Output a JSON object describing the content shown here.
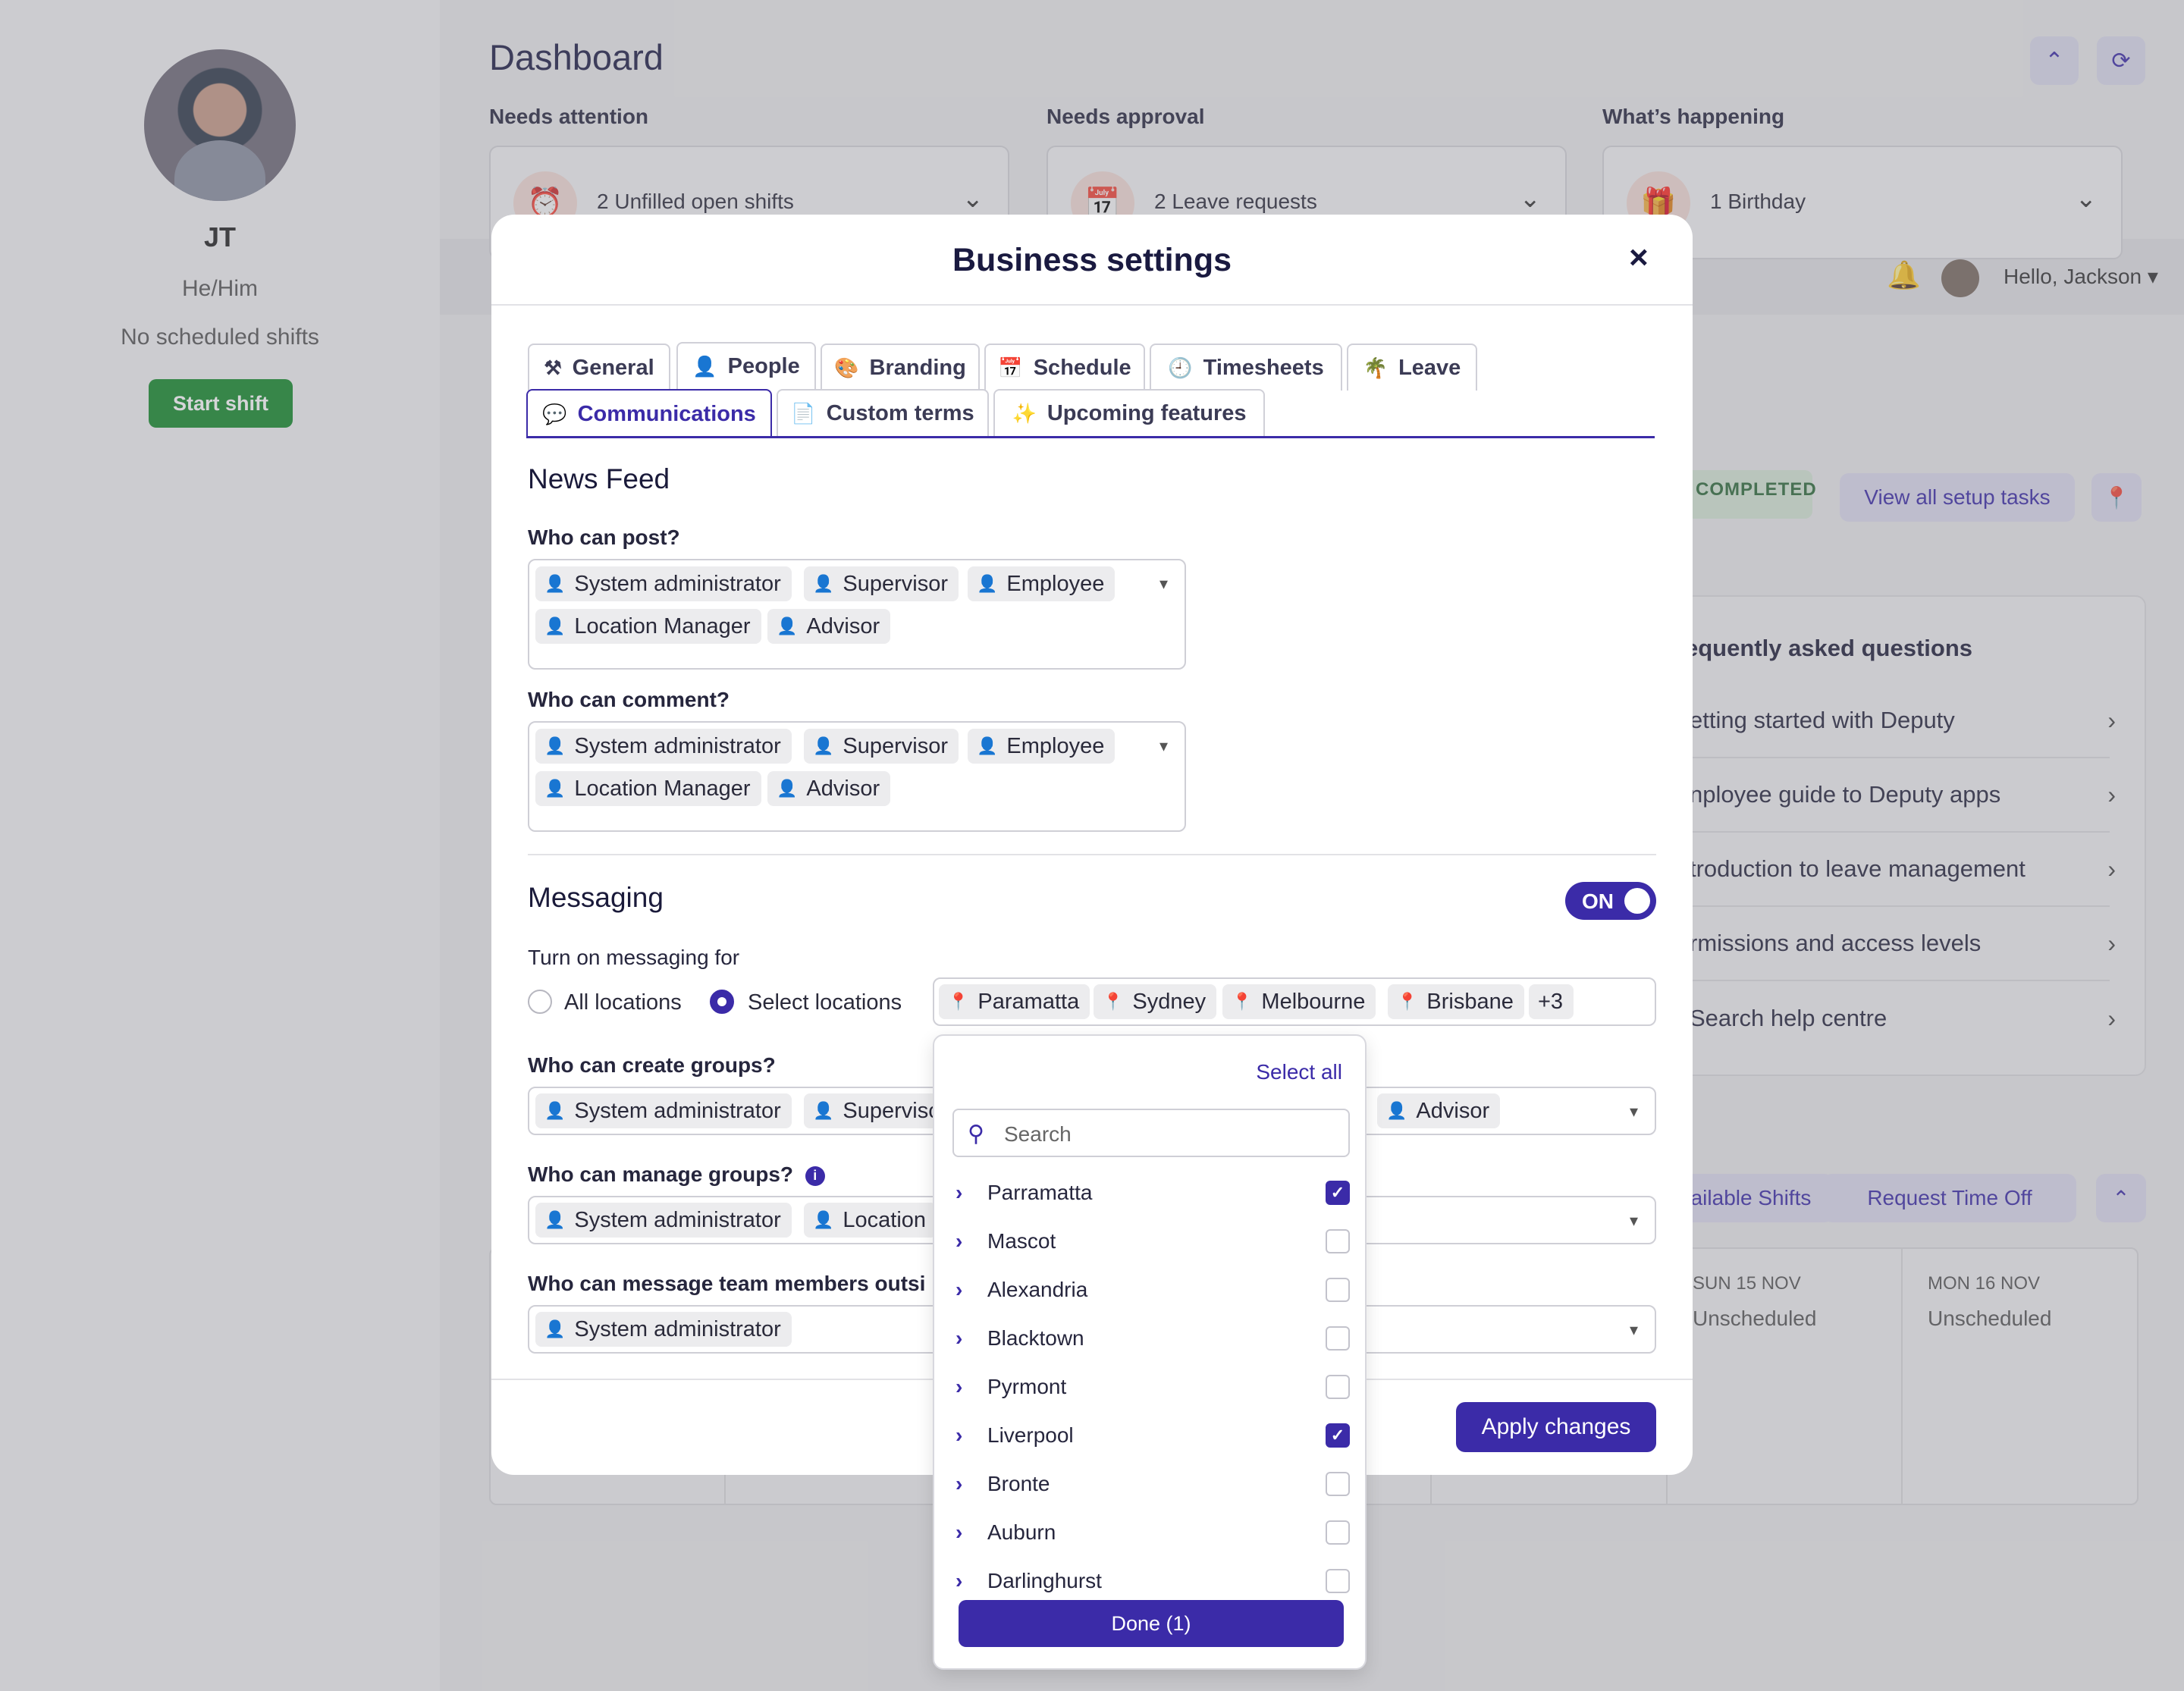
{
  "profile": {
    "name": "JT",
    "pronouns": "He/Him",
    "status": "No scheduled shifts",
    "start_shift": "Start shift"
  },
  "dashboard": {
    "title": "Dashboard",
    "sections": [
      {
        "label": "Needs attention",
        "card_text": "2 Unfilled open shifts",
        "icon": "alarm-clock-icon"
      },
      {
        "label": "Needs approval",
        "card_text": "2 Leave requests",
        "icon": "calendar-check-icon"
      },
      {
        "label": "What’s happening",
        "card_text": "1 Birthday",
        "icon": "gift-icon"
      }
    ],
    "greeting": "Hello, Jackson",
    "completed_badge": "COMPLETED",
    "view_setup": "View all setup tasks",
    "faq_title": "equently asked questions",
    "faq_items": [
      "etting started with Deputy",
      "nployee guide to Deputy apps",
      "troduction to leave management",
      "rmissions and access levels",
      "Search help centre"
    ],
    "shift_buttons": [
      "ailable Shifts",
      "Request Time Off"
    ],
    "calendar": [
      {
        "day": "SUN 15 NOV",
        "value": "Unscheduled"
      },
      {
        "day": "MON 16 NOV",
        "value": "Unscheduled"
      }
    ]
  },
  "modal": {
    "title": "Business settings",
    "close": "×",
    "tabs_row1": [
      "General",
      "People",
      "Branding",
      "Schedule",
      "Timesheets",
      "Leave"
    ],
    "tabs_row2": [
      "Communications",
      "Custom terms",
      "Upcoming features"
    ],
    "active_tab": "Communications",
    "news_feed": {
      "title": "News Feed",
      "who_post_label": "Who can post?",
      "who_post_tags": [
        "System administrator",
        "Supervisor",
        "Employee",
        "Location Manager",
        "Advisor"
      ],
      "who_comment_label": "Who can comment?",
      "who_comment_tags": [
        "System administrator",
        "Supervisor",
        "Employee",
        "Location Manager",
        "Advisor"
      ]
    },
    "messaging": {
      "title": "Messaging",
      "toggle": "ON",
      "turn_on_label": "Turn on messaging for",
      "radio_all": "All locations",
      "radio_select": "Select locations",
      "selected_radio": "Select locations",
      "location_tags": [
        "Paramatta",
        "Sydney",
        "Melbourne",
        "Brisbane"
      ],
      "more_count": "+3",
      "create_groups_label": "Who can create groups?",
      "create_groups_tags": [
        "System administrator",
        "Supervisc",
        "Advisor"
      ],
      "manage_groups_label": "Who can manage groups?",
      "manage_groups_tags": [
        "System administrator",
        "Location"
      ],
      "message_outside_label": "Who can message team members outsi",
      "message_outside_tags": [
        "System administrator"
      ]
    },
    "apply": "Apply changes"
  },
  "location_dropdown": {
    "select_all": "Select all",
    "search_placeholder": "Search",
    "items": [
      {
        "name": "Parramatta",
        "checked": true
      },
      {
        "name": "Mascot",
        "checked": false
      },
      {
        "name": "Alexandria",
        "checked": false
      },
      {
        "name": "Blacktown",
        "checked": false
      },
      {
        "name": "Pyrmont",
        "checked": false
      },
      {
        "name": "Liverpool",
        "checked": true
      },
      {
        "name": "Bronte",
        "checked": false
      },
      {
        "name": "Auburn",
        "checked": false
      },
      {
        "name": "Darlinghurst",
        "checked": false
      }
    ],
    "done": "Done (1)"
  },
  "colors": {
    "accent": "#3b2ba8",
    "start_green": "#148a2b"
  }
}
